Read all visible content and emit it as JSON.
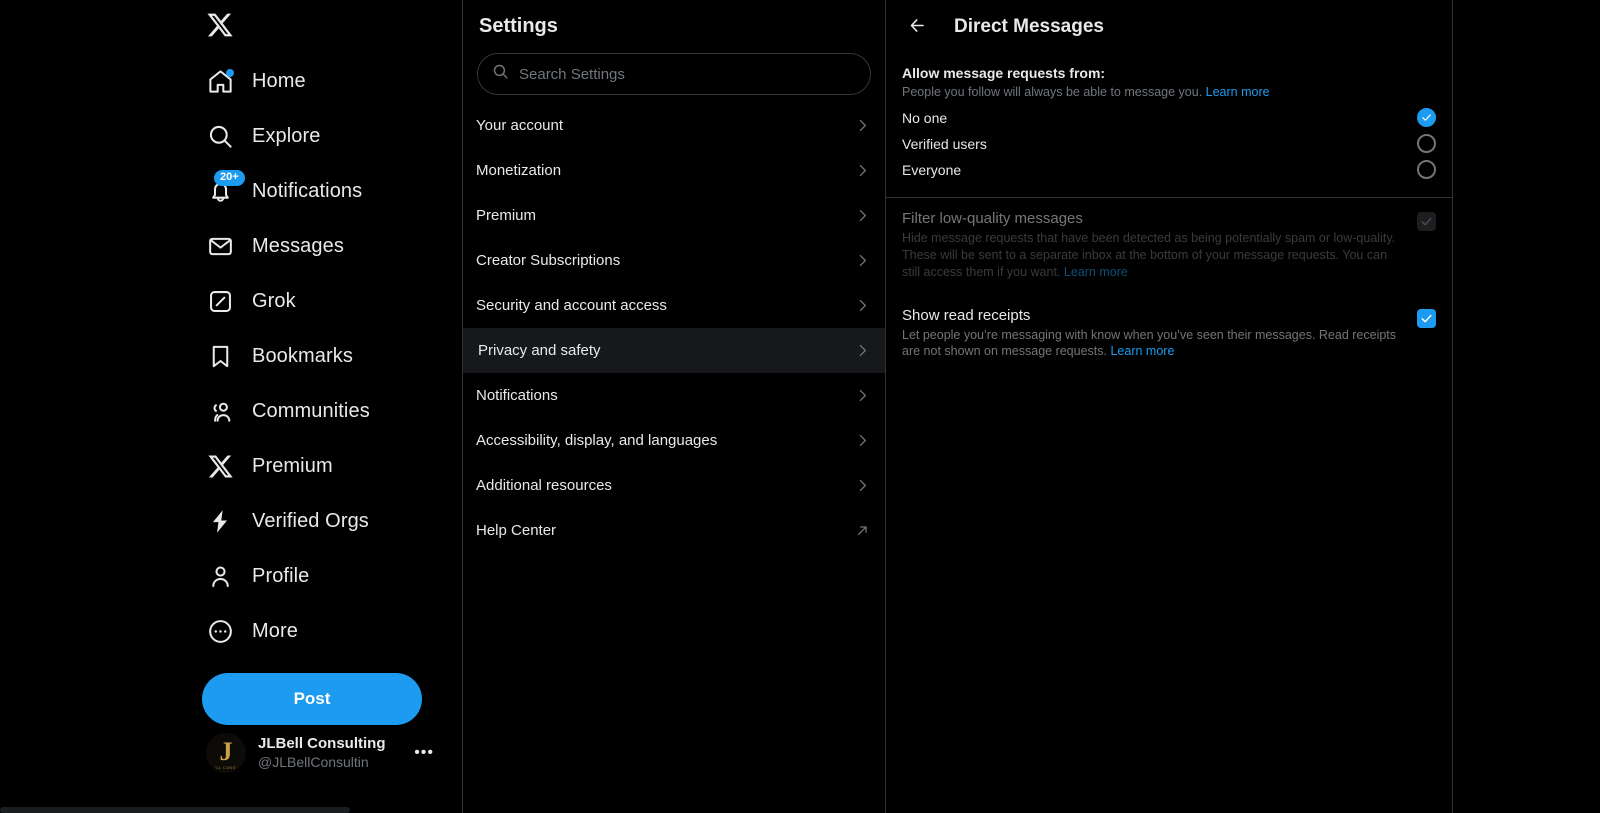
{
  "brand": {
    "accent": "#1d9bf0",
    "bg": "#000000",
    "border": "#2f3336",
    "muted": "#71767b",
    "active_row_bg": "#16181c"
  },
  "leftnav": {
    "logo_icon": "x-logo-icon",
    "items": [
      {
        "label": "Home",
        "icon": "home-icon",
        "badge": "",
        "badge_type": "dot"
      },
      {
        "label": "Explore",
        "icon": "search-icon",
        "badge": "",
        "badge_type": ""
      },
      {
        "label": "Notifications",
        "icon": "bell-icon",
        "badge": "20+",
        "badge_type": "count"
      },
      {
        "label": "Messages",
        "icon": "envelope-icon",
        "badge": "",
        "badge_type": ""
      },
      {
        "label": "Grok",
        "icon": "grok-icon",
        "badge": "",
        "badge_type": ""
      },
      {
        "label": "Bookmarks",
        "icon": "bookmark-icon",
        "badge": "",
        "badge_type": ""
      },
      {
        "label": "Communities",
        "icon": "communities-icon",
        "badge": "",
        "badge_type": ""
      },
      {
        "label": "Premium",
        "icon": "x-logo-icon",
        "badge": "",
        "badge_type": ""
      },
      {
        "label": "Verified Orgs",
        "icon": "lightning-icon",
        "badge": "",
        "badge_type": ""
      },
      {
        "label": "Profile",
        "icon": "person-icon",
        "badge": "",
        "badge_type": ""
      },
      {
        "label": "More",
        "icon": "more-circle-icon",
        "badge": "",
        "badge_type": ""
      }
    ],
    "post_label": "Post",
    "account": {
      "name": "JLBell Consulting",
      "handle": "@JLBellConsultin",
      "avatar_letter": "J",
      "avatar_subtext": "\"LL CONS\"",
      "more_glyph": "•••"
    }
  },
  "settings": {
    "title": "Settings",
    "search": {
      "placeholder": "Search Settings",
      "value": ""
    },
    "items": [
      {
        "label": "Your account",
        "chevron": "chevron-right-icon",
        "active": false
      },
      {
        "label": "Monetization",
        "chevron": "chevron-right-icon",
        "active": false
      },
      {
        "label": "Premium",
        "chevron": "chevron-right-icon",
        "active": false
      },
      {
        "label": "Creator Subscriptions",
        "chevron": "chevron-right-icon",
        "active": false
      },
      {
        "label": "Security and account access",
        "chevron": "chevron-right-icon",
        "active": false
      },
      {
        "label": "Privacy and safety",
        "chevron": "chevron-right-icon",
        "active": true
      },
      {
        "label": "Notifications",
        "chevron": "chevron-right-icon",
        "active": false
      },
      {
        "label": "Accessibility, display, and languages",
        "chevron": "chevron-right-icon",
        "active": false
      },
      {
        "label": "Additional resources",
        "chevron": "chevron-right-icon",
        "active": false
      },
      {
        "label": "Help Center",
        "chevron": "external-link-icon",
        "active": false
      }
    ]
  },
  "detail": {
    "back_icon": "arrow-left-icon",
    "title": "Direct Messages",
    "allow_requests": {
      "title": "Allow message requests from:",
      "description": "People you follow will always be able to message you.",
      "learn_more": "Learn more",
      "options": [
        {
          "label": "No one",
          "selected": true
        },
        {
          "label": "Verified users",
          "selected": false
        },
        {
          "label": "Everyone",
          "selected": false
        }
      ]
    },
    "filter_low_quality": {
      "title": "Filter low-quality messages",
      "description": "Hide message requests that have been detected as being potentially spam or low-quality. These will be sent to a separate inbox at the bottom of your message requests. You can still access them if you want.",
      "learn_more": "Learn more",
      "checked": true,
      "disabled": true
    },
    "show_read_receipts": {
      "title": "Show read receipts",
      "description": "Let people you’re messaging with know when you’ve seen their messages. Read receipts are not shown on message requests.",
      "learn_more": "Learn more",
      "checked": true,
      "disabled": false
    }
  }
}
